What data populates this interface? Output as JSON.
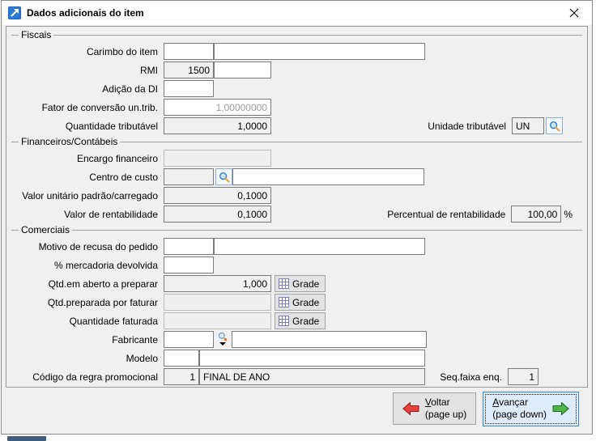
{
  "titlebar": {
    "title": "Dados adicionais do item"
  },
  "icons": {
    "app": "app-chart-arrow-icon",
    "close": "close-icon",
    "lookup": "magnifier-icon",
    "fabricante_lookup": "magnifier-dropdown-icon",
    "grade": "grid-icon",
    "voltar": "arrow-left-red-icon",
    "avancar": "arrow-right-green-icon"
  },
  "colors": {
    "titlebar_bg": "#ffffff",
    "panel_bg": "#f0f0f0",
    "focus_border": "#3b86c7",
    "focus_bg": "#ddecfa",
    "arrow_red": "#e8413c",
    "arrow_green": "#4cb648",
    "lookup_blue": "#2b7bd4"
  },
  "groups": {
    "fiscais": {
      "legend": "Fiscais"
    },
    "financeiros": {
      "legend": "Financeiros/Contábeis"
    },
    "comerciais": {
      "legend": "Comerciais"
    }
  },
  "fields": {
    "carimbo": {
      "label": "Carimbo do item",
      "code": "",
      "desc": ""
    },
    "rmi": {
      "label": "RMI",
      "value": "1500",
      "extra": ""
    },
    "adicao_di": {
      "label": "Adição da DI",
      "value": ""
    },
    "fator_conversao": {
      "label": "Fator de conversão un.trib.",
      "value": "1,00000000"
    },
    "qtd_tributavel": {
      "label": "Quantidade tributável",
      "value": "1,0000"
    },
    "unidade_tributavel": {
      "label": "Unidade tributável",
      "value": "UN"
    },
    "encargo": {
      "label": "Encargo financeiro",
      "value": ""
    },
    "centro_custo": {
      "label": "Centro de custo",
      "code": "",
      "desc": ""
    },
    "valor_unitario": {
      "label": "Valor unitário padrão/carregado",
      "value": "0,1000"
    },
    "valor_rentabilidade": {
      "label": "Valor de rentabilidade",
      "value": "0,1000"
    },
    "percentual_rentabilidade": {
      "label": "Percentual de rentabilidade",
      "value": "100,00",
      "suffix": "%"
    },
    "motivo_recusa": {
      "label": "Motivo de recusa do pedido",
      "code": "",
      "desc": ""
    },
    "merc_devolvida": {
      "label": "% mercadoria devolvida",
      "value": ""
    },
    "qtd_aberto": {
      "label": "Qtd.em aberto a preparar",
      "value": "1,000",
      "button": "Grade"
    },
    "qtd_preparada": {
      "label": "Qtd.preparada por faturar",
      "value": "",
      "button": "Grade"
    },
    "qtd_faturada": {
      "label": "Quantidade faturada",
      "value": "",
      "button": "Grade"
    },
    "fabricante": {
      "label": "Fabricante",
      "code": "",
      "desc": ""
    },
    "modelo": {
      "label": "Modelo",
      "code": "",
      "desc": ""
    },
    "regra_promocional": {
      "label": "Código da regra promocional",
      "code": "1",
      "desc": "FINAL DE ANO"
    },
    "seq_faixa": {
      "label": "Seq.faixa enq.",
      "value": "1"
    }
  },
  "buttons": {
    "voltar": {
      "line1": "Voltar",
      "line2": "(page up)"
    },
    "avancar": {
      "line1": "Avançar",
      "line2": "(page down)"
    }
  }
}
